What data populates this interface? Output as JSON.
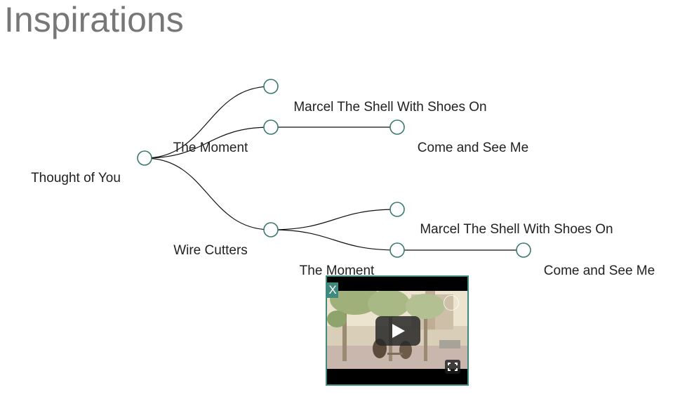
{
  "page": {
    "title": "Inspirations"
  },
  "tree": {
    "root": {
      "label": "Thought of You"
    },
    "branch_a": {
      "label": "The Moment",
      "child_top": {
        "label": ""
      },
      "child_mid": {
        "label": "Marcel The Shell With Shoes On",
        "child": {
          "label": "Come and See Me"
        }
      }
    },
    "branch_b": {
      "label": "Wire Cutters",
      "child_top": {
        "label": "Marcel The Shell With Shoes On"
      },
      "child_mid": {
        "label": "The Moment",
        "child": {
          "label": "Come and See Me"
        }
      }
    }
  },
  "video_popup": {
    "close_label": "X",
    "icons": {
      "play": "play-icon",
      "fullscreen": "fullscreen-icon",
      "watch_later": "clock-icon"
    }
  },
  "colors": {
    "node_stroke": "#3a7a6e",
    "popup_border": "#3f8a7f",
    "title": "#777777"
  }
}
